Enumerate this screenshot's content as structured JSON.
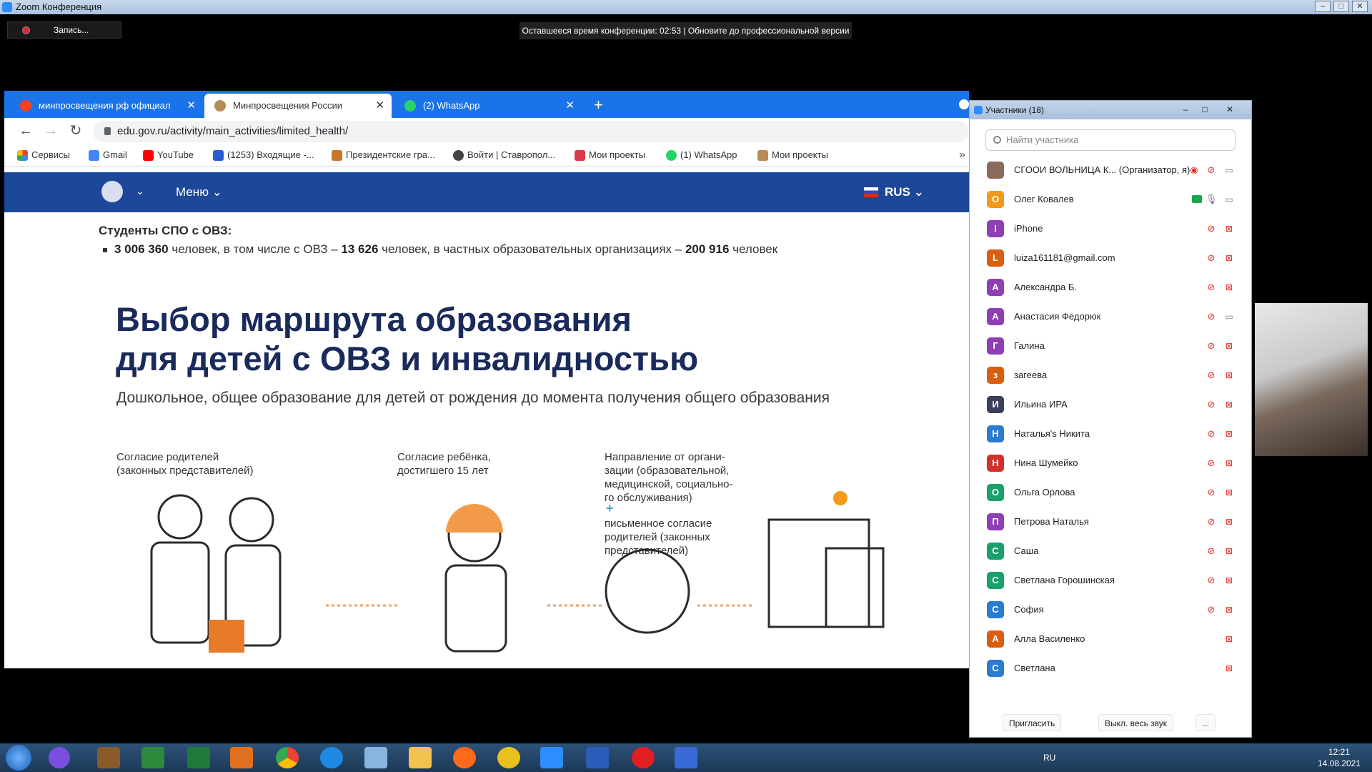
{
  "zoom": {
    "window_title": "Zoom Конференция",
    "record_label": "Запись...",
    "time_banner": "Оставшееся время конференции: 02:53 | Обновите до профессиональной версии"
  },
  "browser": {
    "tabs": [
      {
        "label": "минпросвещения рф официал",
        "icon": "yandex-icon",
        "active": false
      },
      {
        "label": "Минпросвещения России",
        "icon": "emblem-icon",
        "active": true
      },
      {
        "label": "(2) WhatsApp",
        "icon": "whatsapp-icon",
        "active": false
      }
    ],
    "url": "edu.gov.ru/activity/main_activities/limited_health/",
    "bookmarks": [
      "Сервисы",
      "Gmail",
      "YouTube",
      "(1253) Входящие -...",
      "Президентские гра...",
      "Войти | Ставропол...",
      "Мои проекты",
      "(1) WhatsApp",
      "Мои проекты"
    ]
  },
  "site": {
    "menu_label": "Меню",
    "lang": "RUS",
    "students_title": "Студенты СПО с ОВЗ:",
    "students_line": {
      "n1": "3 006 360",
      "t1": " человек, в том числе с ОВЗ – ",
      "n2": "13 626",
      "t2": " человек, в частных образовательных организациях – ",
      "n3": "200 916",
      "t3": " человек"
    },
    "headline_1": "Выбор маршрута образования",
    "headline_2": "для детей с ОВЗ и инвалидностью",
    "subline": "Дошкольное, общее образование для детей от рождения до момента получения общего образования",
    "caption_1": "Согласие родителей\n(законных представителей)",
    "caption_2": "Согласие ребёнка,\nдостигшего 15 лет",
    "caption_3": "Направление от органи-\nзации (образовательной,\nмедицинской, социально-\nго обслуживания)",
    "caption_plus": "+",
    "caption_4": "письменное согласие\nродителей (законных\nпредставителей)"
  },
  "participants": {
    "title": "Участники (18)",
    "search_placeholder": "Найти участника",
    "list": [
      {
        "initial": "",
        "name": "СГООИ ВОЛЬНИЦА К... (Организатор, я)",
        "color": "#8a6a5a",
        "mic": "muted",
        "cam": "on",
        "rec": true
      },
      {
        "initial": "О",
        "name": "Олег Ковалев",
        "color": "#f29a1a",
        "mic": "on",
        "cam": "on",
        "share": true
      },
      {
        "initial": "I",
        "name": "iPhone",
        "color": "#8e3fb3",
        "mic": "muted",
        "cam": "off"
      },
      {
        "initial": "L",
        "name": "luiza161181@gmail.com",
        "color": "#d95f0e",
        "mic": "muted",
        "cam": "off"
      },
      {
        "initial": "А",
        "name": "Александра Б.",
        "color": "#8e3fb3",
        "mic": "muted",
        "cam": "off"
      },
      {
        "initial": "А",
        "name": "Анастасия Федорюк",
        "color": "#8e3fb3",
        "mic": "muted",
        "cam": "on"
      },
      {
        "initial": "Г",
        "name": "Галина",
        "color": "#8e3fb3",
        "mic": "muted",
        "cam": "off"
      },
      {
        "initial": "з",
        "name": "загеева",
        "color": "#d95f0e",
        "mic": "muted",
        "cam": "off"
      },
      {
        "initial": "И",
        "name": "Ильина ИРА",
        "color": "#3b3f58",
        "mic": "muted",
        "cam": "off"
      },
      {
        "initial": "Н",
        "name": "Наталья's Никита",
        "color": "#2b7bd1",
        "mic": "muted",
        "cam": "off"
      },
      {
        "initial": "Н",
        "name": "Нина Шумейко",
        "color": "#d0312d",
        "mic": "muted",
        "cam": "off"
      },
      {
        "initial": "О",
        "name": "Ольга Орлова",
        "color": "#1aa06b",
        "mic": "muted",
        "cam": "off"
      },
      {
        "initial": "П",
        "name": "Петрова Наталья",
        "color": "#8e3fb3",
        "mic": "muted",
        "cam": "off"
      },
      {
        "initial": "С",
        "name": "Саша",
        "color": "#1aa06b",
        "mic": "muted",
        "cam": "off"
      },
      {
        "initial": "С",
        "name": "Светлана Горошинская",
        "color": "#1aa06b",
        "mic": "muted",
        "cam": "off"
      },
      {
        "initial": "С",
        "name": "София",
        "color": "#2b7bd1",
        "mic": "muted",
        "cam": "off"
      },
      {
        "initial": "А",
        "name": "Алла Василенко",
        "color": "#d95f0e",
        "mic": "none",
        "cam": "off"
      },
      {
        "initial": "С",
        "name": "Светлана",
        "color": "#2b7bd1",
        "mic": "none",
        "cam": "off"
      }
    ],
    "invite_label": "Пригласить",
    "mute_all_label": "Выкл. весь звук",
    "more_label": "..."
  },
  "taskbar": {
    "lang": "RU",
    "time": "12:21",
    "date": "14.08.2021"
  }
}
